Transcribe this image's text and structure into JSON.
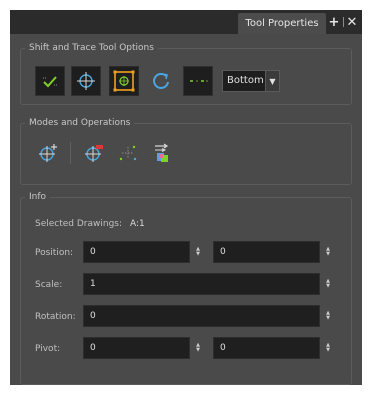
{
  "window": {
    "tab_title": "Tool Properties",
    "add_icon": "plus-icon",
    "close_icon": "close-icon"
  },
  "shift_trace": {
    "title": "Shift and Trace Tool Options",
    "buttons": [
      {
        "name": "show-outline-button",
        "icon": "check-onion-icon"
      },
      {
        "name": "reposition-button",
        "icon": "crosshair-icon"
      },
      {
        "name": "reset-button",
        "icon": "frame-target-icon"
      },
      {
        "name": "reset-all-button",
        "icon": "rotate-icon"
      },
      {
        "name": "tracing-mode-button",
        "icon": "dash-dot-icon"
      }
    ],
    "position_select": {
      "value": "Bottom"
    }
  },
  "modes": {
    "title": "Modes and Operations",
    "buttons": [
      {
        "name": "pivot-mode-button",
        "icon": "pivot-crosshair-icon"
      },
      {
        "name": "add-reference-button",
        "icon": "crosshair-flag-icon"
      },
      {
        "name": "animate-button",
        "icon": "dotted-path-icon"
      },
      {
        "name": "swap-button",
        "icon": "swap-layers-icon"
      }
    ]
  },
  "info": {
    "title": "Info",
    "selected_drawings_label": "Selected Drawings:",
    "selected_drawings_value": "A:1",
    "position": {
      "label": "Position:",
      "x": "0",
      "y": "0"
    },
    "scale": {
      "label": "Scale:",
      "value": "1"
    },
    "rotation": {
      "label": "Rotation:",
      "value": "0"
    },
    "pivot": {
      "label": "Pivot:",
      "x": "0",
      "y": "0"
    }
  },
  "colors": {
    "accent_green": "#7fd12a",
    "accent_orange": "#f0a020",
    "accent_blue": "#4aa6e0",
    "accent_red": "#e0363a"
  }
}
